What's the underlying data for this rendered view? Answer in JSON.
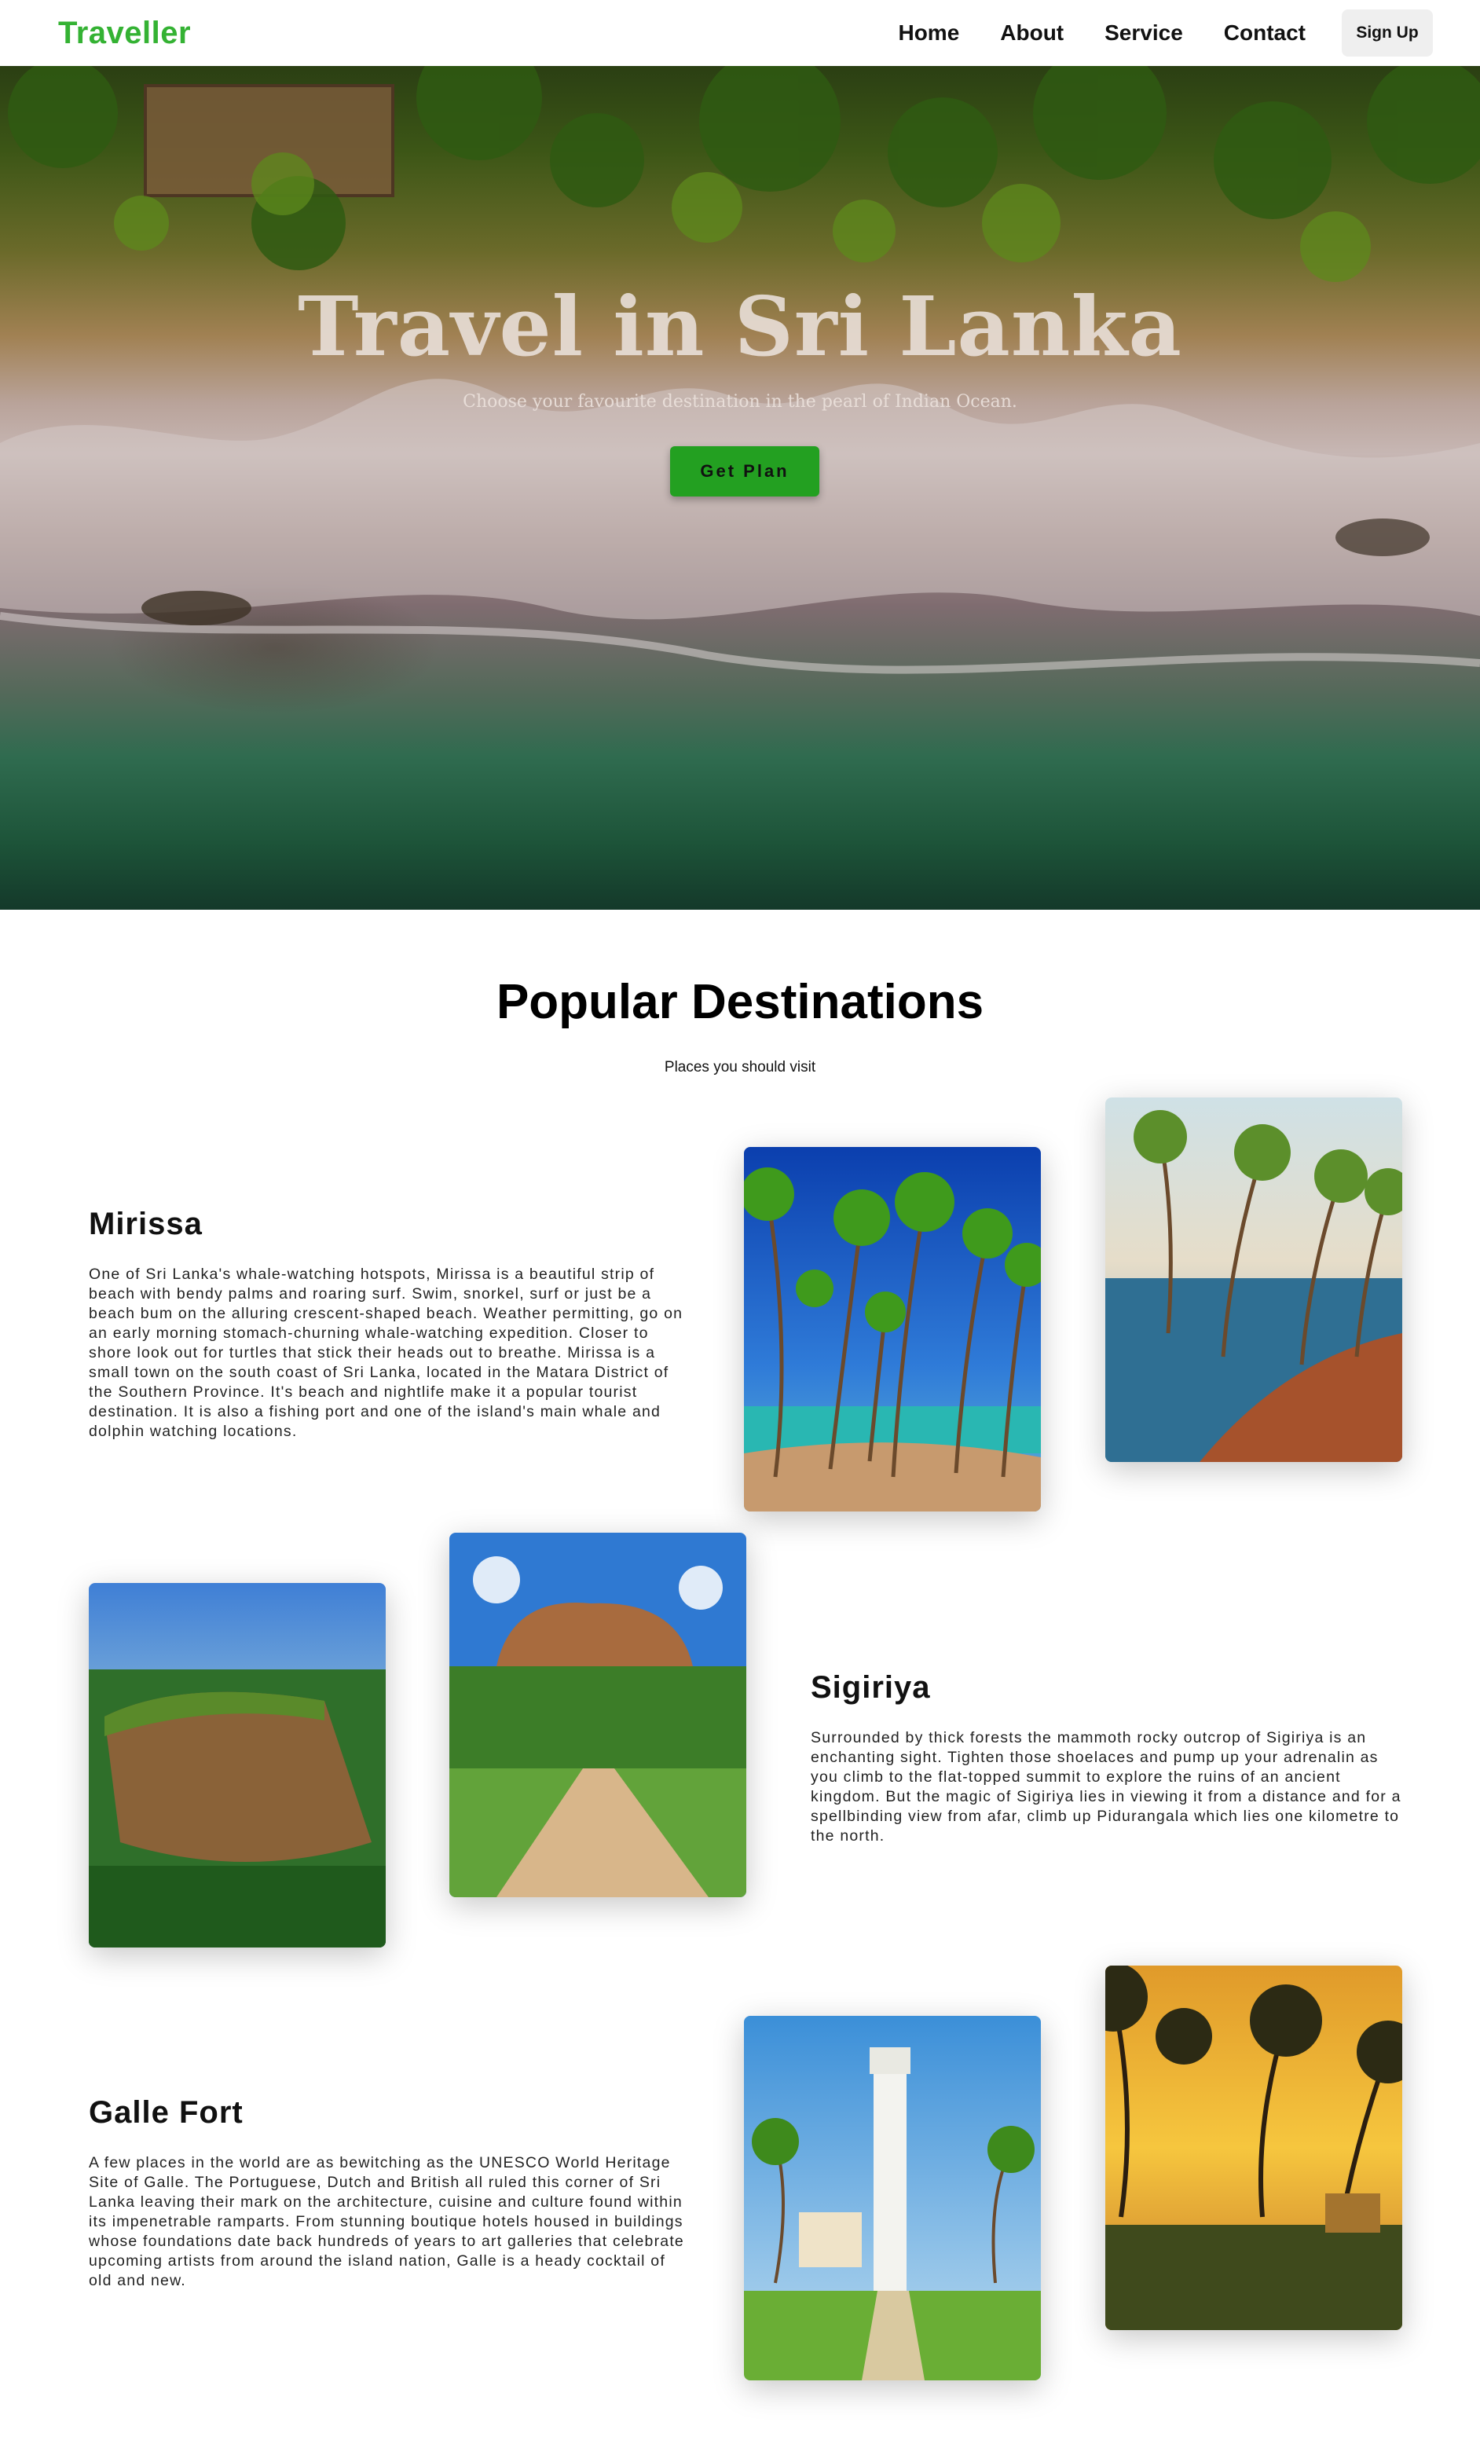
{
  "nav": {
    "brand": "Traveller",
    "links": [
      "Home",
      "About",
      "Service",
      "Contact"
    ],
    "signup": "Sign Up"
  },
  "hero": {
    "title": "Travel in Sri Lanka",
    "subtitle": "Choose your favourite destination in the pearl of Indian Ocean.",
    "button": "Get Plan"
  },
  "section": {
    "title": "Popular Destinations",
    "subtitle": "Places you should visit"
  },
  "destinations": [
    {
      "name": "Mirissa",
      "description": "One of Sri Lanka's whale-watching hotspots, Mirissa is a beautiful strip of beach with bendy palms and roaring surf. Swim, snorkel, surf or just be a beach bum on the alluring crescent-shaped beach. Weather permitting, go on an early morning stomach-churning whale-watching expedition. Closer to shore look out for turtles that stick their heads out to breathe. Mirissa is a small town on the south coast of Sri Lanka, located in the Matara District of the Southern Province. It's beach and nightlife make it a popular tourist destination. It is also a fishing port and one of the island's main whale and dolphin watching locations."
    },
    {
      "name": "Sigiriya",
      "description": "Surrounded by thick forests the mammoth rocky outcrop of Sigiriya is an enchanting sight. Tighten those shoelaces and pump up your adrenalin as you climb to the flat-topped summit to explore the ruins of an ancient kingdom. But the magic of Sigiriya lies in viewing it from a distance and for a spellbinding view from afar, climb up Pidurangala which lies one kilometre to the north."
    },
    {
      "name": "Galle Fort",
      "description": "A few places in the world are as bewitching as the UNESCO World Heritage Site of Galle. The Portuguese, Dutch and British all ruled this corner of Sri Lanka leaving their mark on the architecture, cuisine and culture found within its impenetrable ramparts. From stunning boutique hotels housed in buildings whose foundations date back hundreds of years to art galleries that celebrate upcoming artists from around the island nation, Galle is a heady cocktail of old and new."
    }
  ],
  "colors": {
    "accent": "#34b233",
    "button": "#23a021"
  }
}
